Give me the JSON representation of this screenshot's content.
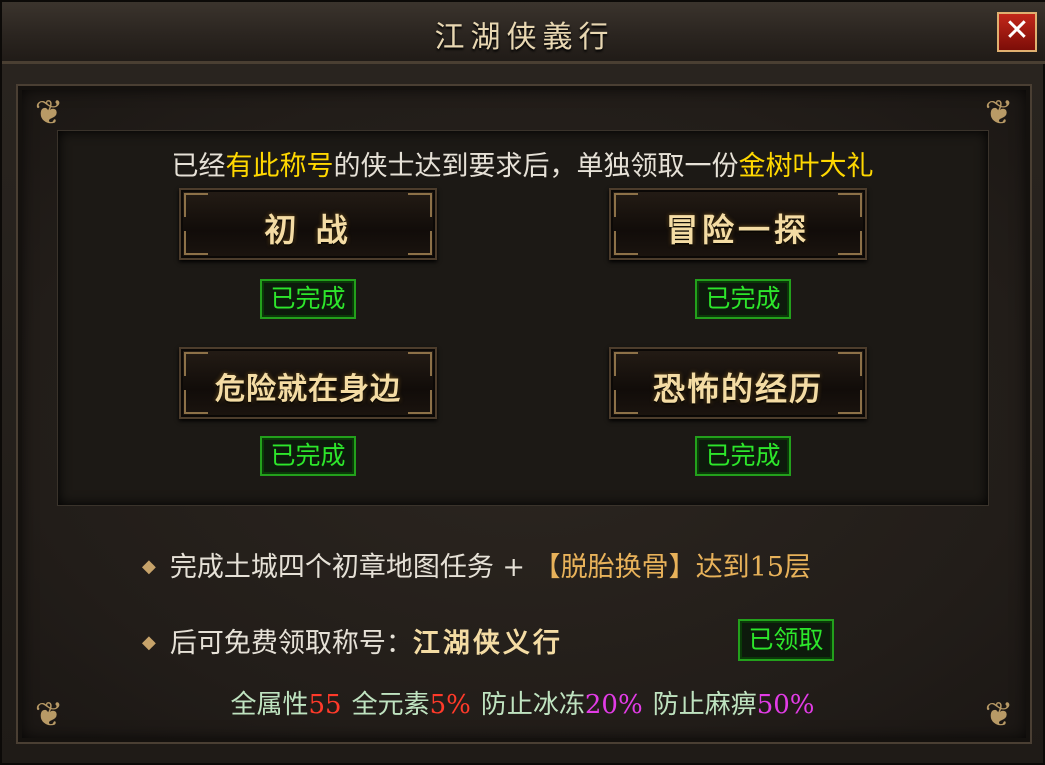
{
  "window": {
    "title": "江湖侠義行",
    "close_label": "✕"
  },
  "requirement": {
    "prefix": "已经",
    "highlight1": "有此称号",
    "middle": "的侠士达到要求后，单独领取一份",
    "highlight2": "金树叶大礼"
  },
  "badges": [
    {
      "name": "初 战",
      "status": "已完成"
    },
    {
      "name": "冒险一探",
      "status": "已完成"
    },
    {
      "name": "危险就在身边",
      "status": "已完成"
    },
    {
      "name": "恐怖的经历",
      "status": "已完成"
    }
  ],
  "condition": {
    "text": "完成土城四个初章地图任务 + ",
    "highlight": "【脱胎换骨】达到15层"
  },
  "reward": {
    "text": "后可免费领取称号：",
    "title_name": "江湖侠义行",
    "claim_label": "已领取"
  },
  "stats": [
    {
      "label": "全属性",
      "value": "55"
    },
    {
      "label": "全元素",
      "value": "5%"
    },
    {
      "label": "防止冰冻",
      "value": "20%"
    },
    {
      "label": "防止麻痹",
      "value": "50%"
    }
  ],
  "colors": {
    "highlight_yellow": "#ffd800",
    "status_green": "#2de62b",
    "stat_red": "#ff3a2a",
    "stat_purple": "#e23ce6",
    "condition_orange": "#e8b25a"
  }
}
